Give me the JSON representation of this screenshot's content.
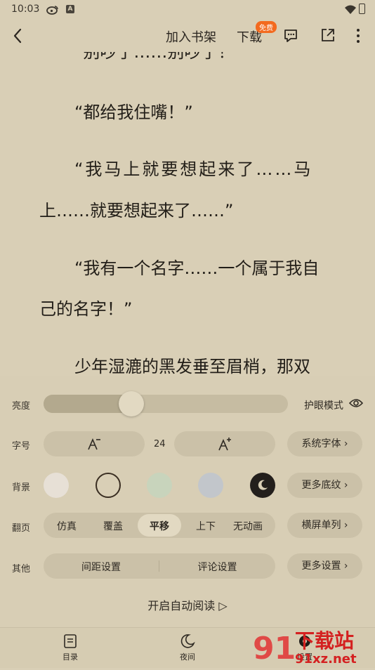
{
  "status_bar": {
    "time": "10:03",
    "notif_letter": "A"
  },
  "topbar": {
    "add_shelf": "加入书架",
    "download": "下载",
    "free_badge": "免费",
    "icons": [
      "back-icon",
      "comment-icon",
      "share-icon",
      "more-icon"
    ]
  },
  "content": {
    "line0": "“别吵了……别吵了！”",
    "p1": "“都给我住嘴！”",
    "p2a": "“我马上就要想起来了……马",
    "p2b": "上……就要想起来了……”",
    "p3a": "“我有一个名字……一个属于我自",
    "p3b": "己的名字！”",
    "p4a": "少年湿漉的黑发垂至眉梢，那双"
  },
  "settings": {
    "brightness": {
      "label": "亮度",
      "value": 0.36,
      "eye_mode": "护眼模式"
    },
    "fontsize": {
      "label": "字号",
      "value": "24",
      "system_font": "系统字体 ›"
    },
    "background": {
      "label": "背景",
      "more": "更多底纹 ›",
      "swatches": [
        "#e7e0d6",
        "#d9cfb6",
        "#c8d4bc",
        "#c2c6cb",
        "#231f1c"
      ],
      "selected": 1
    },
    "page_turn": {
      "label": "翻页",
      "options": [
        "仿真",
        "覆盖",
        "平移",
        "上下",
        "无动画"
      ],
      "selected": 2,
      "landscape": "横屏单列 ›"
    },
    "other": {
      "label": "其他",
      "spacing": "间距设置",
      "comments": "评论设置",
      "more": "更多设置 ›"
    },
    "auto_read": "开启自动阅读 ▷"
  },
  "bottom_nav": {
    "toc": "目录",
    "night": "夜间",
    "settings": "设置"
  },
  "watermark": {
    "text": "下载站",
    "domain": "91xz.net",
    "digits": "91"
  }
}
